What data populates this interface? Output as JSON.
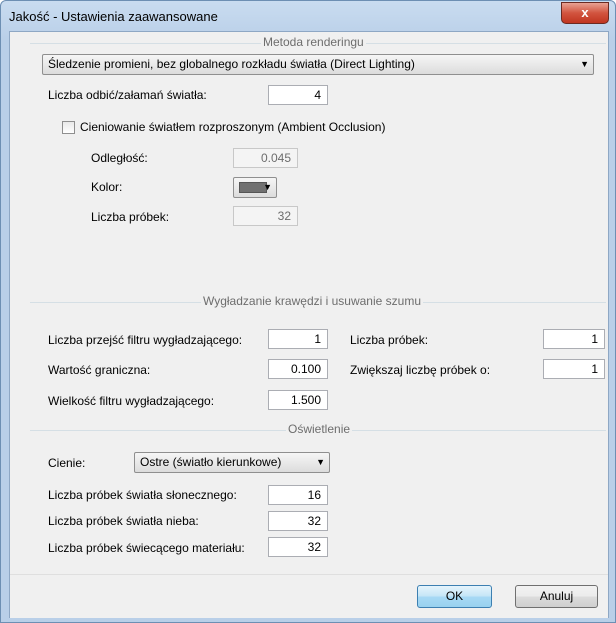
{
  "window": {
    "title": "Jakość - Ustawienia zaawansowane",
    "close_symbol": "x"
  },
  "rendering": {
    "group_title": "Metoda renderingu",
    "method_selected": "Śledzenie promieni, bez globalnego rozkładu światła (Direct Lighting)",
    "bounces_label": "Liczba odbić/załamań światła:",
    "bounces_value": "4",
    "ao_checkbox_label": "Cieniowanie światłem rozproszonym (Ambient Occlusion)",
    "ao_checked": false,
    "distance_label": "Odległość:",
    "distance_value": "0.045",
    "color_label": "Kolor:",
    "color_value": "#707070",
    "samples_label": "Liczba próbek:",
    "samples_value": "32"
  },
  "antialiasing": {
    "group_title": "Wygładzanie krawędzi i usuwanie szumu",
    "passes_label": "Liczba przejść filtru wygładzającego:",
    "passes_value": "1",
    "threshold_label": "Wartość graniczna:",
    "threshold_value": "0.100",
    "filter_size_label": "Wielkość filtru wygładzającego:",
    "filter_size_value": "1.500",
    "samples_label": "Liczba próbek:",
    "samples_value": "1",
    "increase_label": "Zwiększaj liczbę próbek o:",
    "increase_value": "1"
  },
  "lighting": {
    "group_title": "Oświetlenie",
    "shadows_label": "Cienie:",
    "shadows_selected": "Ostre (światło kierunkowe)",
    "sun_samples_label": "Liczba próbek światła słonecznego:",
    "sun_samples_value": "16",
    "sky_samples_label": "Liczba próbek światła nieba:",
    "sky_samples_value": "32",
    "emissive_samples_label": "Liczba próbek świecącego materiału:",
    "emissive_samples_value": "32"
  },
  "buttons": {
    "ok": "OK",
    "cancel": "Anuluj"
  }
}
